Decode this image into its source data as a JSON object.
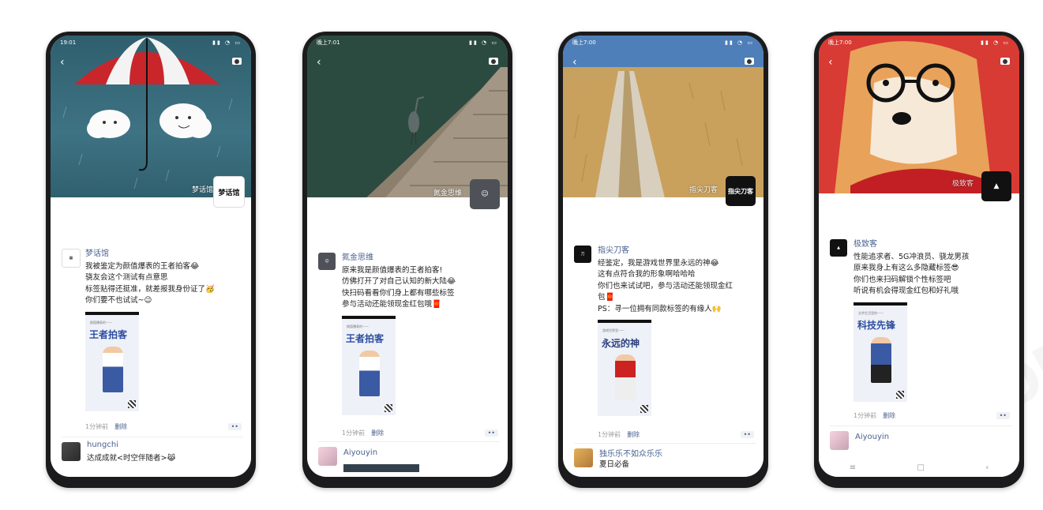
{
  "phones": [
    {
      "status_time": "19:01",
      "owner_name": "梦话馆",
      "owner_avatar_text": "梦话馆",
      "post": {
        "name": "梦话馆",
        "lines": [
          "我被鉴定为颜值爆表的王者拍客😂",
          "骁友会这个测试有点意思",
          "标签贴得还挺准，就差报我身份证了🥳",
          "你们要不也试试~😉"
        ],
        "poster_head": "颜值爆表的——",
        "poster_title": "王者拍客"
      },
      "time": "1分钟前",
      "delete": "删除",
      "more": "••",
      "comment": {
        "name": "hungchi",
        "text": "达成成就<时空伴随者>😹"
      }
    },
    {
      "status_time": "晚上7:01",
      "owner_name": "氮金思维",
      "post": {
        "name": "氮金思维",
        "lines": [
          "原来我是颜值爆表的王者拍客!",
          "仿佛打开了对自己认知的新大陆😂",
          "快扫码看看你们身上都有哪些标签",
          "参与活动还能领现金红包哦🧧"
        ],
        "poster_head": "颜值爆表的——",
        "poster_title": "王者拍客"
      },
      "time": "1分钟前",
      "delete": "删除",
      "more": "••",
      "comment": {
        "name": "Aiyouyin",
        "text": ""
      }
    },
    {
      "status_time": "晚上7:00",
      "owner_name": "指尖刀客",
      "owner_avatar_text": "指尖刀客",
      "post": {
        "name": "指尖刀客",
        "lines": [
          "经鉴定，我是游戏世界里永远的神😂",
          "这有点符合我的形象啊哈哈哈",
          "你们也来试试吧，参与活动还能领现金红",
          "包🧧",
          "PS：寻一位拥有同款标签的有缘人🙌"
        ],
        "poster_head": "游戏世界里——",
        "poster_title": "永远的神"
      },
      "time": "1分钟前",
      "delete": "删除",
      "more": "••",
      "comment": {
        "name": "独乐乐不如众乐乐",
        "text": "夏日必备"
      }
    },
    {
      "status_time": "晚上7:00",
      "owner_name": "极致客",
      "post": {
        "name": "极致客",
        "lines": [
          "性能追求者、5G冲浪员、骁龙男孩",
          "原来我身上有这么多隐藏标签😎",
          "你们也来扫码解锁个性标签吧",
          "听说有机会得现金红包和好礼哦"
        ],
        "poster_head": "业余生活里的——",
        "poster_title": "科技先锋"
      },
      "time": "1分钟前",
      "delete": "删除",
      "more": "••",
      "comment": {
        "name": "Aiyouyin",
        "text": ""
      },
      "nav": [
        "≡",
        "□",
        "‹"
      ]
    }
  ]
}
